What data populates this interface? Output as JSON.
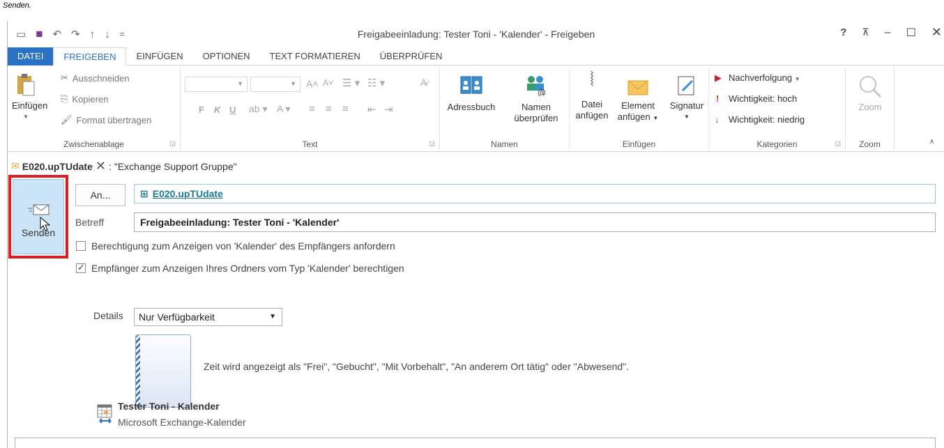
{
  "caption": "Senden.",
  "window": {
    "title": "Freigabeeinladung: Tester Toni - 'Kalender' - Freigeben"
  },
  "tabs": [
    {
      "label": "DATEI"
    },
    {
      "label": "FREIGEBEN"
    },
    {
      "label": "EINFÜGEN"
    },
    {
      "label": "OPTIONEN"
    },
    {
      "label": "TEXT FORMATIEREN"
    },
    {
      "label": "ÜBERPRÜFEN"
    }
  ],
  "ribbon": {
    "clipboard": {
      "label": "Zwischenablage",
      "paste": "Einfügen",
      "cut": "Ausschneiden",
      "copy": "Kopieren",
      "format_painter": "Format übertragen"
    },
    "text": {
      "label": "Text",
      "bold": "F",
      "italic": "K",
      "underline": "U"
    },
    "names": {
      "label": "Namen",
      "address_book": "Adressbuch",
      "check_names_1": "Namen",
      "check_names_2": "überprüfen"
    },
    "insert": {
      "label": "Einfügen",
      "attach_file_1": "Datei",
      "attach_file_2": "anfügen",
      "attach_item_1": "Element",
      "attach_item_2": "anfügen",
      "signature": "Signatur"
    },
    "tags": {
      "label": "Kategorien",
      "followup": "Nachverfolgung",
      "high": "Wichtigkeit: hoch",
      "low": "Wichtigkeit: niedrig"
    },
    "zoom": {
      "label": "Zoom",
      "button": "Zoom"
    }
  },
  "message": {
    "account": "E020.upTUdate",
    "recipient_group": "\"Exchange Support Gruppe\"",
    "send": "Senden",
    "to_button": "An...",
    "to_value": "E020.upTUdate",
    "subject_label": "Betreff",
    "subject_value": "Freigabeeinladung: Tester Toni - 'Kalender'",
    "request_permission": "Berechtigung zum Anzeigen von 'Kalender' des Empfängers anfordern",
    "request_checked": false,
    "allow_view": "Empfänger zum Anzeigen Ihres Ordners vom Typ 'Kalender' berechtigen",
    "allow_checked": true,
    "details_label": "Details",
    "details_value": "Nur Verfügbarkeit",
    "details_description": "Zeit wird angezeigt als \"Frei\", \"Gebucht\", \"Mit Vorbehalt\", \"An anderem Ort tätig\" oder \"Abwesend\".",
    "calendar_name": "Tester Toni - Kalender",
    "calendar_type": "Microsoft Exchange-Kalender"
  }
}
